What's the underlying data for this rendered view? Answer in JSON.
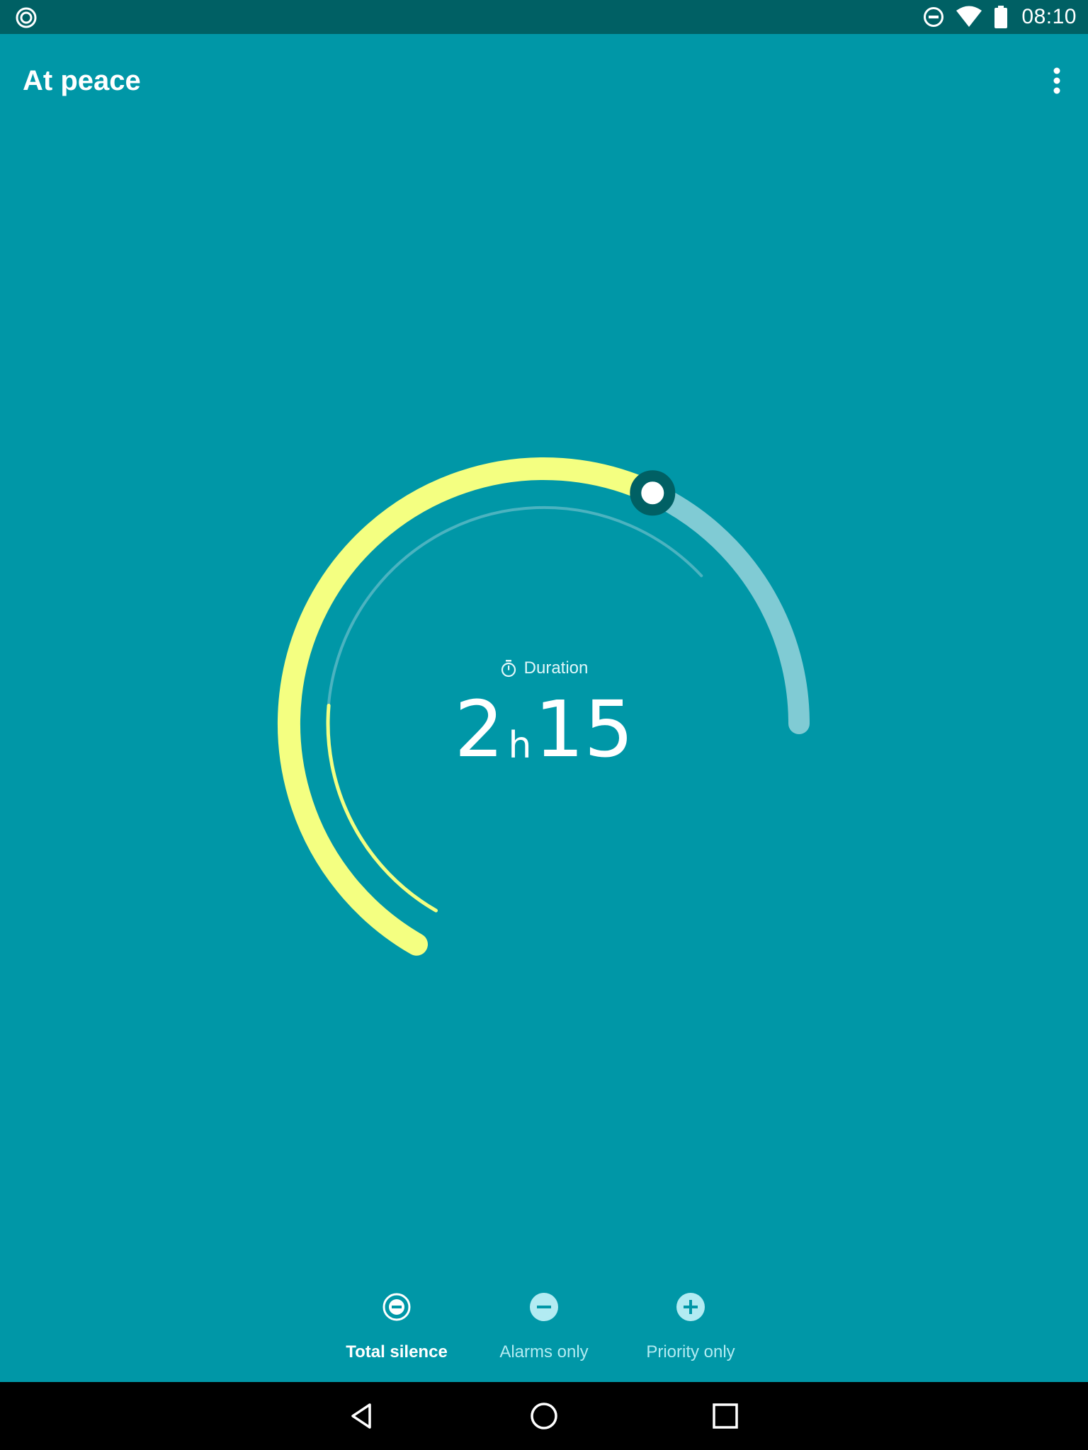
{
  "status_bar": {
    "time": "08:10",
    "left_icon": "ring-icon",
    "right_icons": [
      "dnd-icon",
      "wifi-icon",
      "battery-icon"
    ]
  },
  "app_bar": {
    "title": "At peace",
    "menu_icon": "more-vert-icon"
  },
  "dial": {
    "label": "Duration",
    "label_icon": "timer-icon",
    "hours": "2",
    "hours_unit": "h",
    "minutes": "15",
    "outer_progress_fraction": 0.73,
    "inner_progress_fraction": 0.27,
    "colors": {
      "active": "#f4ff81",
      "track": "#80cbd4",
      "handle": "#006064"
    }
  },
  "modes": [
    {
      "label": "Total silence",
      "icon": "minus-circle-outline-icon",
      "active": true
    },
    {
      "label": "Alarms only",
      "icon": "minus-circle-icon",
      "active": false
    },
    {
      "label": "Priority only",
      "icon": "plus-circle-icon",
      "active": false
    }
  ],
  "nav_bar": {
    "buttons": [
      "back-icon",
      "home-icon",
      "recents-icon"
    ]
  },
  "colors": {
    "background": "#0097a7",
    "status_bar": "#006064",
    "nav_bar": "#000000"
  }
}
